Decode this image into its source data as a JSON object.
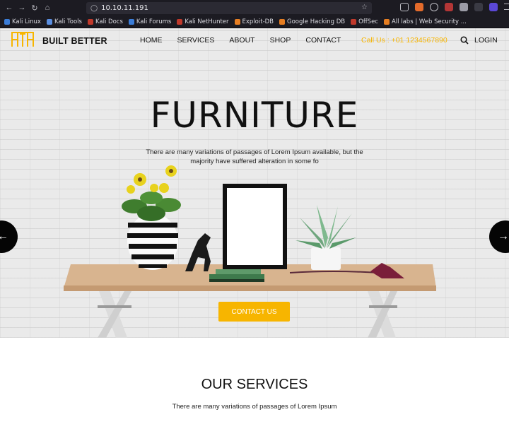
{
  "browser": {
    "url": "10.10.11.191",
    "bookmarks": [
      {
        "label": "Kali Linux",
        "color": "#3b7dd8"
      },
      {
        "label": "Kali Tools",
        "color": "#5a8ee0"
      },
      {
        "label": "Kali Docs",
        "color": "#c0392b"
      },
      {
        "label": "Kali Forums",
        "color": "#3b7dd8"
      },
      {
        "label": "Kali NetHunter",
        "color": "#c0392b"
      },
      {
        "label": "Exploit-DB",
        "color": "#e67e22"
      },
      {
        "label": "Google Hacking DB",
        "color": "#e67e22"
      },
      {
        "label": "OffSec",
        "color": "#c0392b"
      },
      {
        "label": "All labs | Web Security ...",
        "color": "#e67e22"
      }
    ]
  },
  "site": {
    "brand": "BUILT BETTER",
    "menu": [
      "HOME",
      "SERVICES",
      "ABOUT",
      "SHOP",
      "CONTACT"
    ],
    "call": "Call Us : +01 1234567890",
    "login": "LOGIN"
  },
  "hero": {
    "title": "FURNITURE",
    "subtitle": "There are many variations of passages of Lorem Ipsum available, but the majority have suffered alteration in some fo",
    "cta": "CONTACT US"
  },
  "services": {
    "title": "OUR SERVICES",
    "subtitle": "There are many variations of passages of Lorem Ipsum"
  },
  "colors": {
    "accent": "#f7b500",
    "browser_bg": "#1c1b22"
  }
}
